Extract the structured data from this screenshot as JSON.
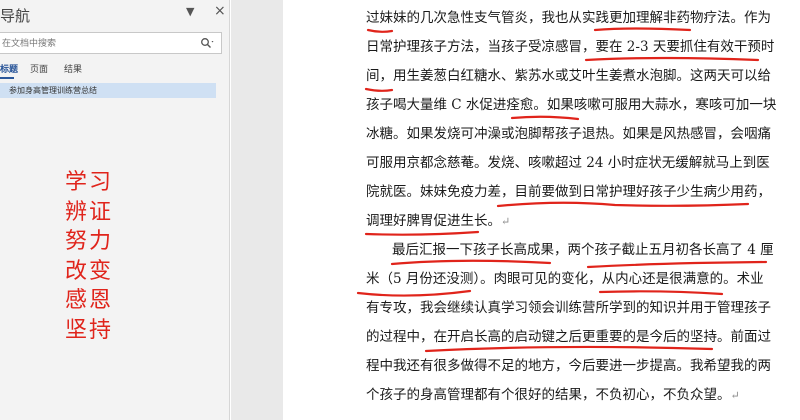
{
  "nav": {
    "title": "导航",
    "search_placeholder": "在文档中搜索",
    "tabs": [
      "标题",
      "页面",
      "结果"
    ],
    "items": [
      "参加身高管理训练营总结"
    ]
  },
  "keywords": [
    "学习",
    "辨证",
    "努力",
    "改变",
    "感恩",
    "坚持"
  ],
  "document": {
    "lines": [
      "过妹妹的几次急性支气管炎，我也从实践更加理解非药物疗法。作为",
      "日常护理孩子方法，当孩子受凉感冒，要在 2-3 天要抓住有效干预时",
      "间，用生姜葱白红糖水、紫苏水或艾叶生姜煮水泡脚。这两天可以给",
      "孩子喝大量维 C 水促进痊愈。如果咳嗽可服用大蒜水，寒咳可加一块",
      "冰糖。如果发烧可冲澡或泡脚帮孩子退热。如果是风热感冒，会咽痛",
      "可服用京都念慈菴。发烧、咳嗽超过 24 小时症状无缓解就马上到医",
      "院就医。妹妹免疫力差，目前要做到日常护理好孩子少生病少用药，",
      "调理好脾胃促进生长。",
      "最后汇报一下孩子长高成果，两个孩子截止五月初各长高了 4 厘",
      "米（5 月份还没测）。肉眼可见的变化，从内心还是很满意的。术业",
      "有专攻，我会继续认真学习领会训练营所学到的知识并用于管理孩子",
      "的过程中，在开启长高的启动键之后更重要的是今后的坚持。前面过",
      "程中我还有很多做得不足的地方，今后要进一步提高。我希望我的两",
      "个孩子的身高管理都有个很好的结果，不负初心，不负众望。"
    ],
    "paragraph_mark": "↵"
  },
  "colors": {
    "annotation_red": "#e0241b",
    "nav_bg": "#f3f3f3",
    "nav_selected": "#cfe0f3"
  }
}
